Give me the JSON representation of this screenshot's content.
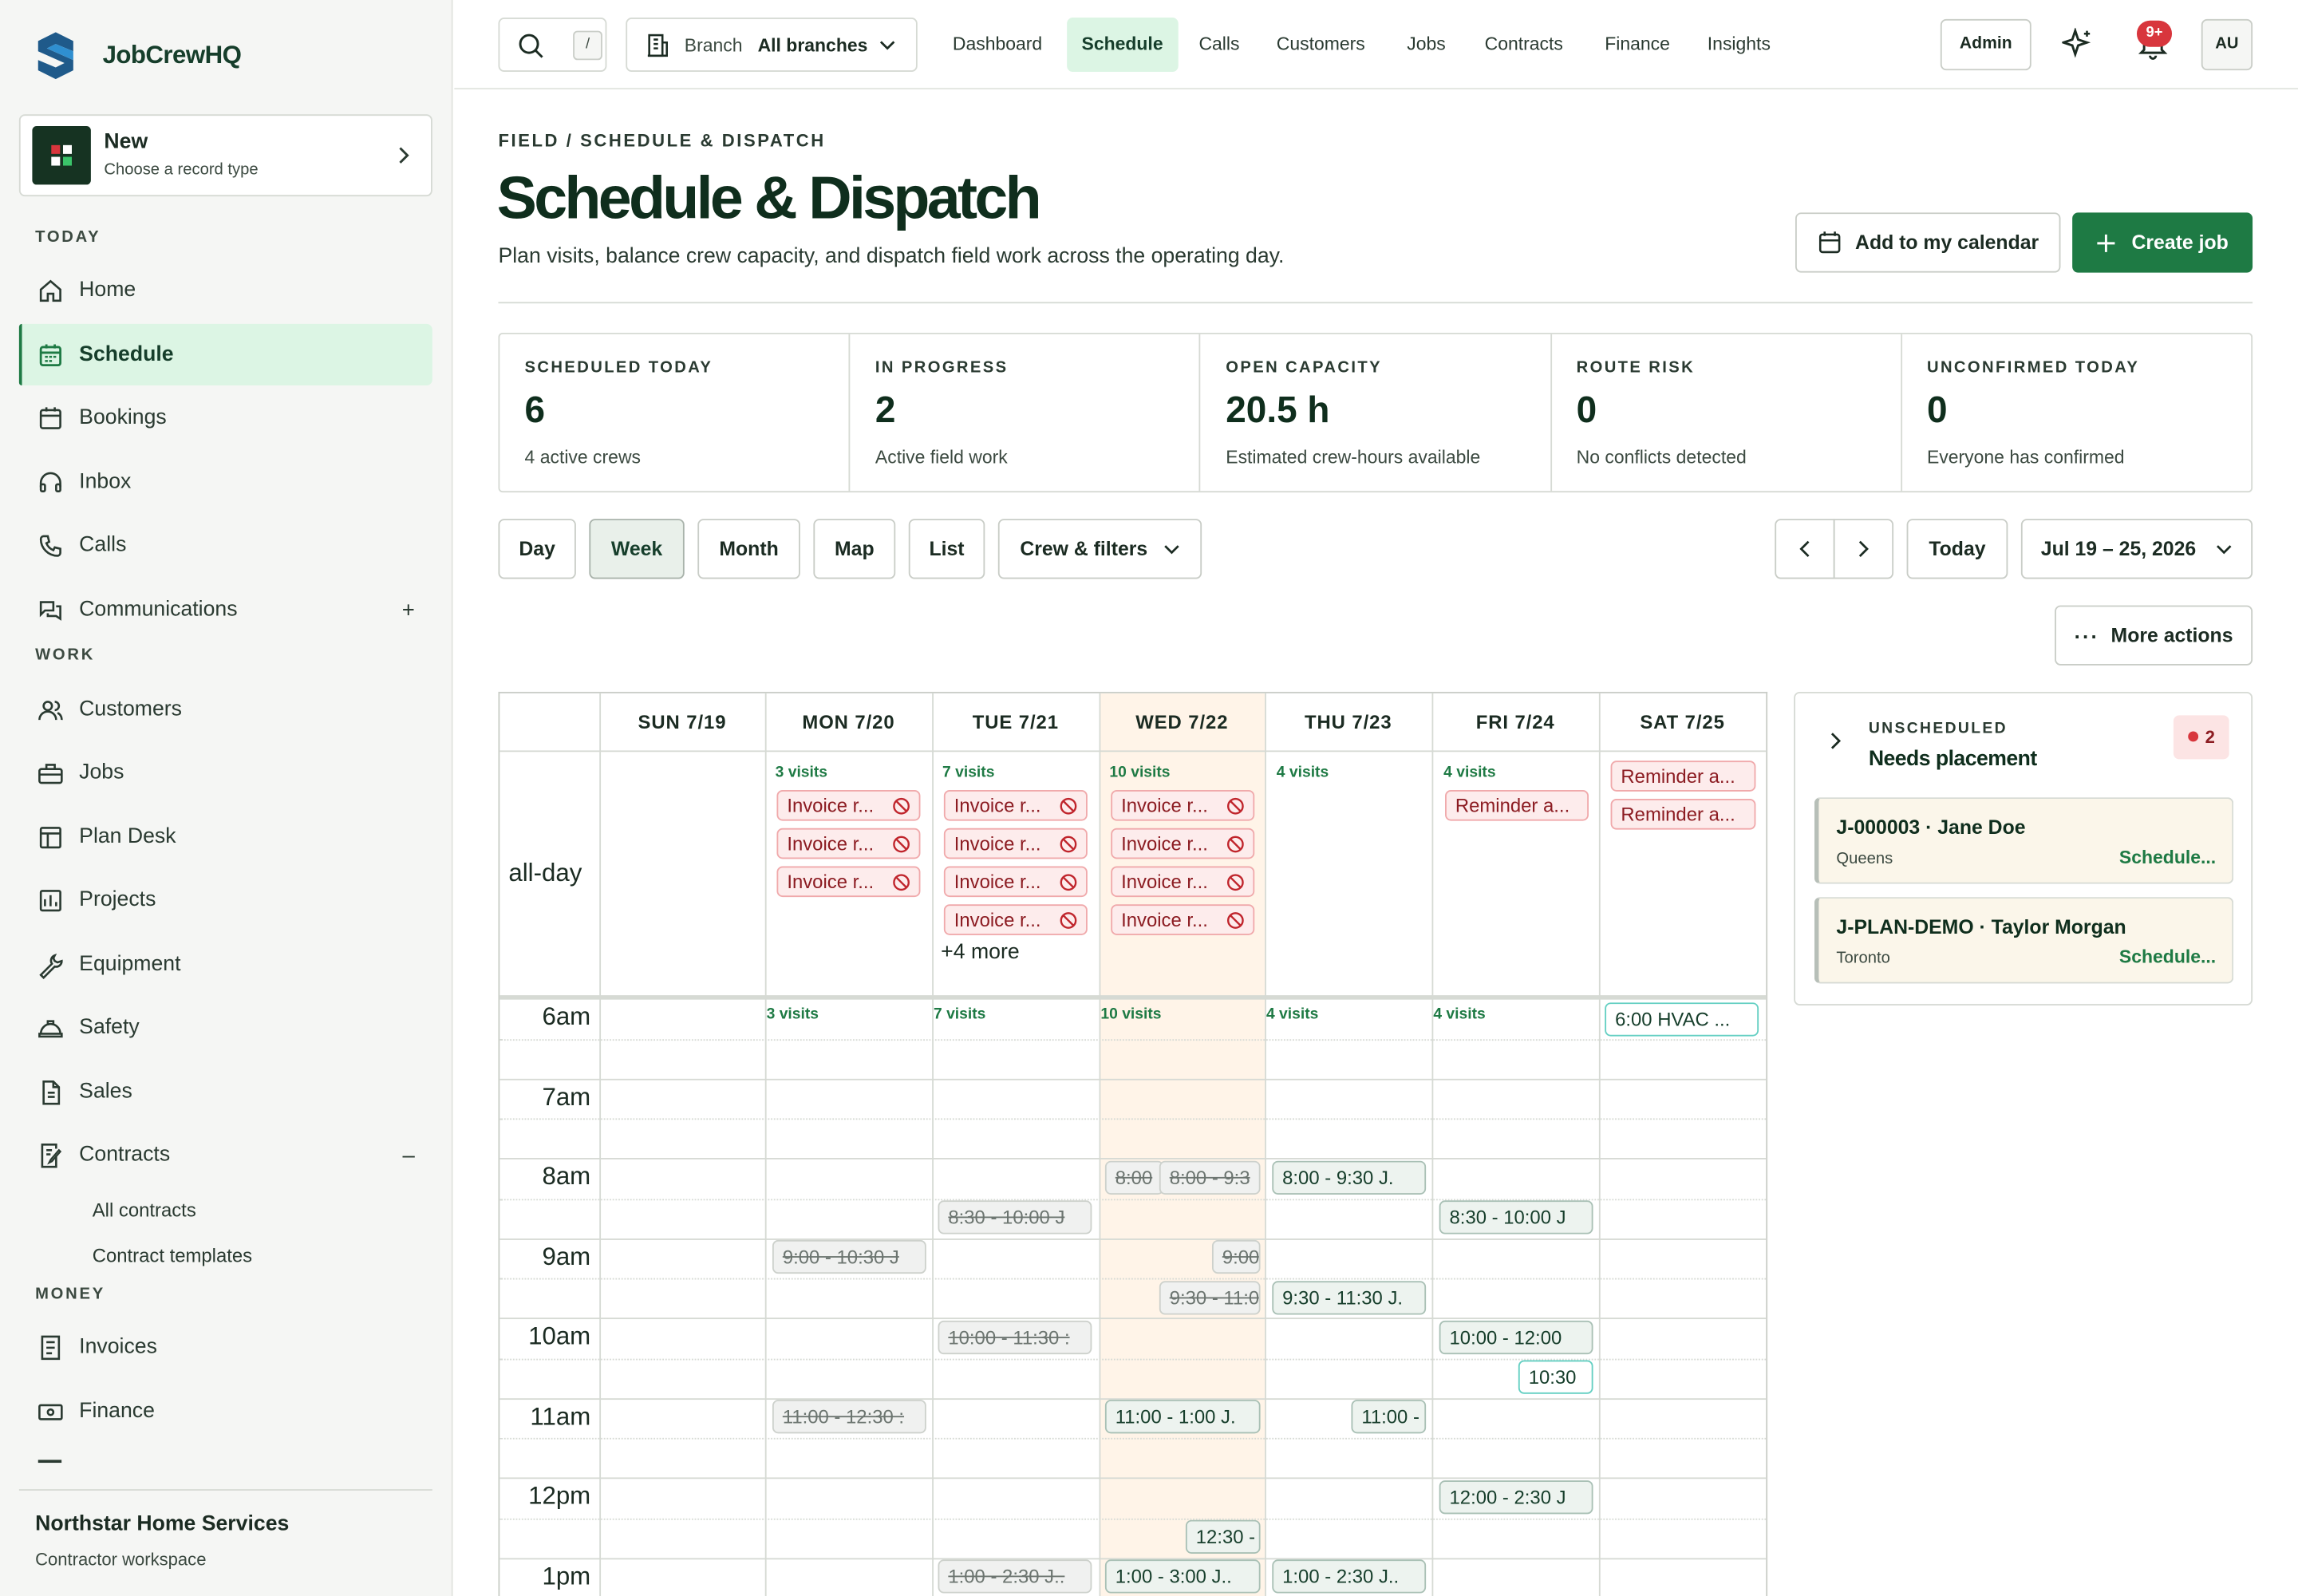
{
  "brand": {
    "name": "JobCrewHQ"
  },
  "new_card": {
    "title": "New",
    "subtitle": "Choose a record type"
  },
  "sidebar": {
    "sections": {
      "today": "TODAY",
      "work": "WORK",
      "money": "MONEY"
    },
    "items": [
      {
        "label": "Home",
        "icon": "home-icon"
      },
      {
        "label": "Schedule",
        "icon": "calendar-icon",
        "active": true
      },
      {
        "label": "Bookings",
        "icon": "calendar-check-icon"
      },
      {
        "label": "Inbox",
        "icon": "headset-icon"
      },
      {
        "label": "Calls",
        "icon": "phone-icon"
      },
      {
        "label": "Communications",
        "icon": "chat-icon",
        "toggle": "+"
      },
      {
        "label": "Customers",
        "icon": "users-icon"
      },
      {
        "label": "Jobs",
        "icon": "toolbox-icon"
      },
      {
        "label": "Plan Desk",
        "icon": "layout-icon"
      },
      {
        "label": "Projects",
        "icon": "projects-icon"
      },
      {
        "label": "Equipment",
        "icon": "wrench-icon"
      },
      {
        "label": "Safety",
        "icon": "hardhat-icon"
      },
      {
        "label": "Sales",
        "icon": "document-icon"
      },
      {
        "label": "Contracts",
        "icon": "contract-icon",
        "toggle": "–"
      },
      {
        "label": "Invoices",
        "icon": "invoice-icon"
      },
      {
        "label": "Finance",
        "icon": "money-icon"
      }
    ],
    "contracts_sub": [
      "All contracts",
      "Contract templates"
    ],
    "footer": {
      "org": "Northstar Home Services",
      "workspace": "Contractor workspace"
    }
  },
  "topbar": {
    "search_shortcut": "/",
    "branch_label": "Branch",
    "branch_value": "All branches",
    "nav": [
      "Dashboard",
      "Schedule",
      "Calls",
      "Customers",
      "Jobs",
      "Contracts",
      "Finance",
      "Insights"
    ],
    "active_nav": "Schedule",
    "admin": "Admin",
    "notif_badge": "9+",
    "avatar": "AU"
  },
  "page": {
    "breadcrumb": "FIELD / SCHEDULE & DISPATCH",
    "title": "Schedule & Dispatch",
    "subtitle": "Plan visits, balance crew capacity, and dispatch field work across the operating day.",
    "add_calendar": "Add to my calendar",
    "create_job": "Create job"
  },
  "stats": [
    {
      "label": "SCHEDULED TODAY",
      "value": "6",
      "note": "4 active crews"
    },
    {
      "label": "IN PROGRESS",
      "value": "2",
      "note": "Active field work"
    },
    {
      "label": "OPEN CAPACITY",
      "value": "20.5 h",
      "note": "Estimated crew-hours available"
    },
    {
      "label": "ROUTE RISK",
      "value": "0",
      "note": "No conflicts detected"
    },
    {
      "label": "UNCONFIRMED TODAY",
      "value": "0",
      "note": "Everyone has confirmed"
    }
  ],
  "views": [
    "Day",
    "Week",
    "Month",
    "Map",
    "List"
  ],
  "active_view": "Week",
  "filters": "Crew & filters",
  "today_btn": "Today",
  "date_range": "Jul 19 – 25, 2026",
  "more_actions": "More actions",
  "calendar": {
    "days": [
      "SUN 7/19",
      "MON 7/20",
      "TUE 7/21",
      "WED 7/22",
      "THU 7/23",
      "FRI 7/24",
      "SAT 7/25"
    ],
    "all_day_label": "all-day",
    "all_day_counts": [
      "",
      "3 visits",
      "7 visits",
      "10 visits",
      "4 visits",
      "4 visits",
      ""
    ],
    "hour_counts": [
      "",
      "3 visits",
      "7 visits",
      "10 visits",
      "4 visits",
      "4 visits",
      ""
    ],
    "hours": [
      "6am",
      "7am",
      "8am",
      "9am",
      "10am",
      "11am",
      "12pm",
      "1pm"
    ],
    "invoice_chip": "Invoice r...",
    "reminder_chip": "Reminder a...",
    "more_link": "+4 more",
    "events": {
      "sat_hvac": "6:00 HVAC ...",
      "wed_800a": "8:00",
      "wed_800b": "8:00 - 9:3",
      "thu_800": "8:00 - 9:30 J.",
      "tue_830": "8:30 - 10:00 J",
      "fri_830": "8:30 - 10:00 J",
      "mon_900": "9:00 - 10:30 J",
      "wed_900": "9:00",
      "wed_930": "9:30 - 11:0",
      "thu_930": "9:30 - 11:30 J.",
      "tue_1000": "10:00 - 11:30 :",
      "fri_1000": "10:00 - 12:00",
      "fri_1030": "10:30",
      "mon_1100": "11:00 - 12:30 :",
      "wed_1100": "11:00 - 1:00 J.",
      "thu_1100": "11:00 -",
      "fri_1200": "12:00 - 2:30 J",
      "wed_1230": "12:30 -",
      "tue_100": "1:00 - 2:30 J..",
      "wed_100": "1:00 - 3:00 J..",
      "thu_100": "1:00 - 2:30 J.."
    }
  },
  "unscheduled": {
    "label": "UNSCHEDULED",
    "title": "Needs placement",
    "count": "2",
    "cards": [
      {
        "title": "J-000003 · Jane Doe",
        "location": "Queens",
        "action": "Schedule..."
      },
      {
        "title": "J-PLAN-DEMO · Taylor Morgan",
        "location": "Toronto",
        "action": "Schedule..."
      }
    ]
  }
}
